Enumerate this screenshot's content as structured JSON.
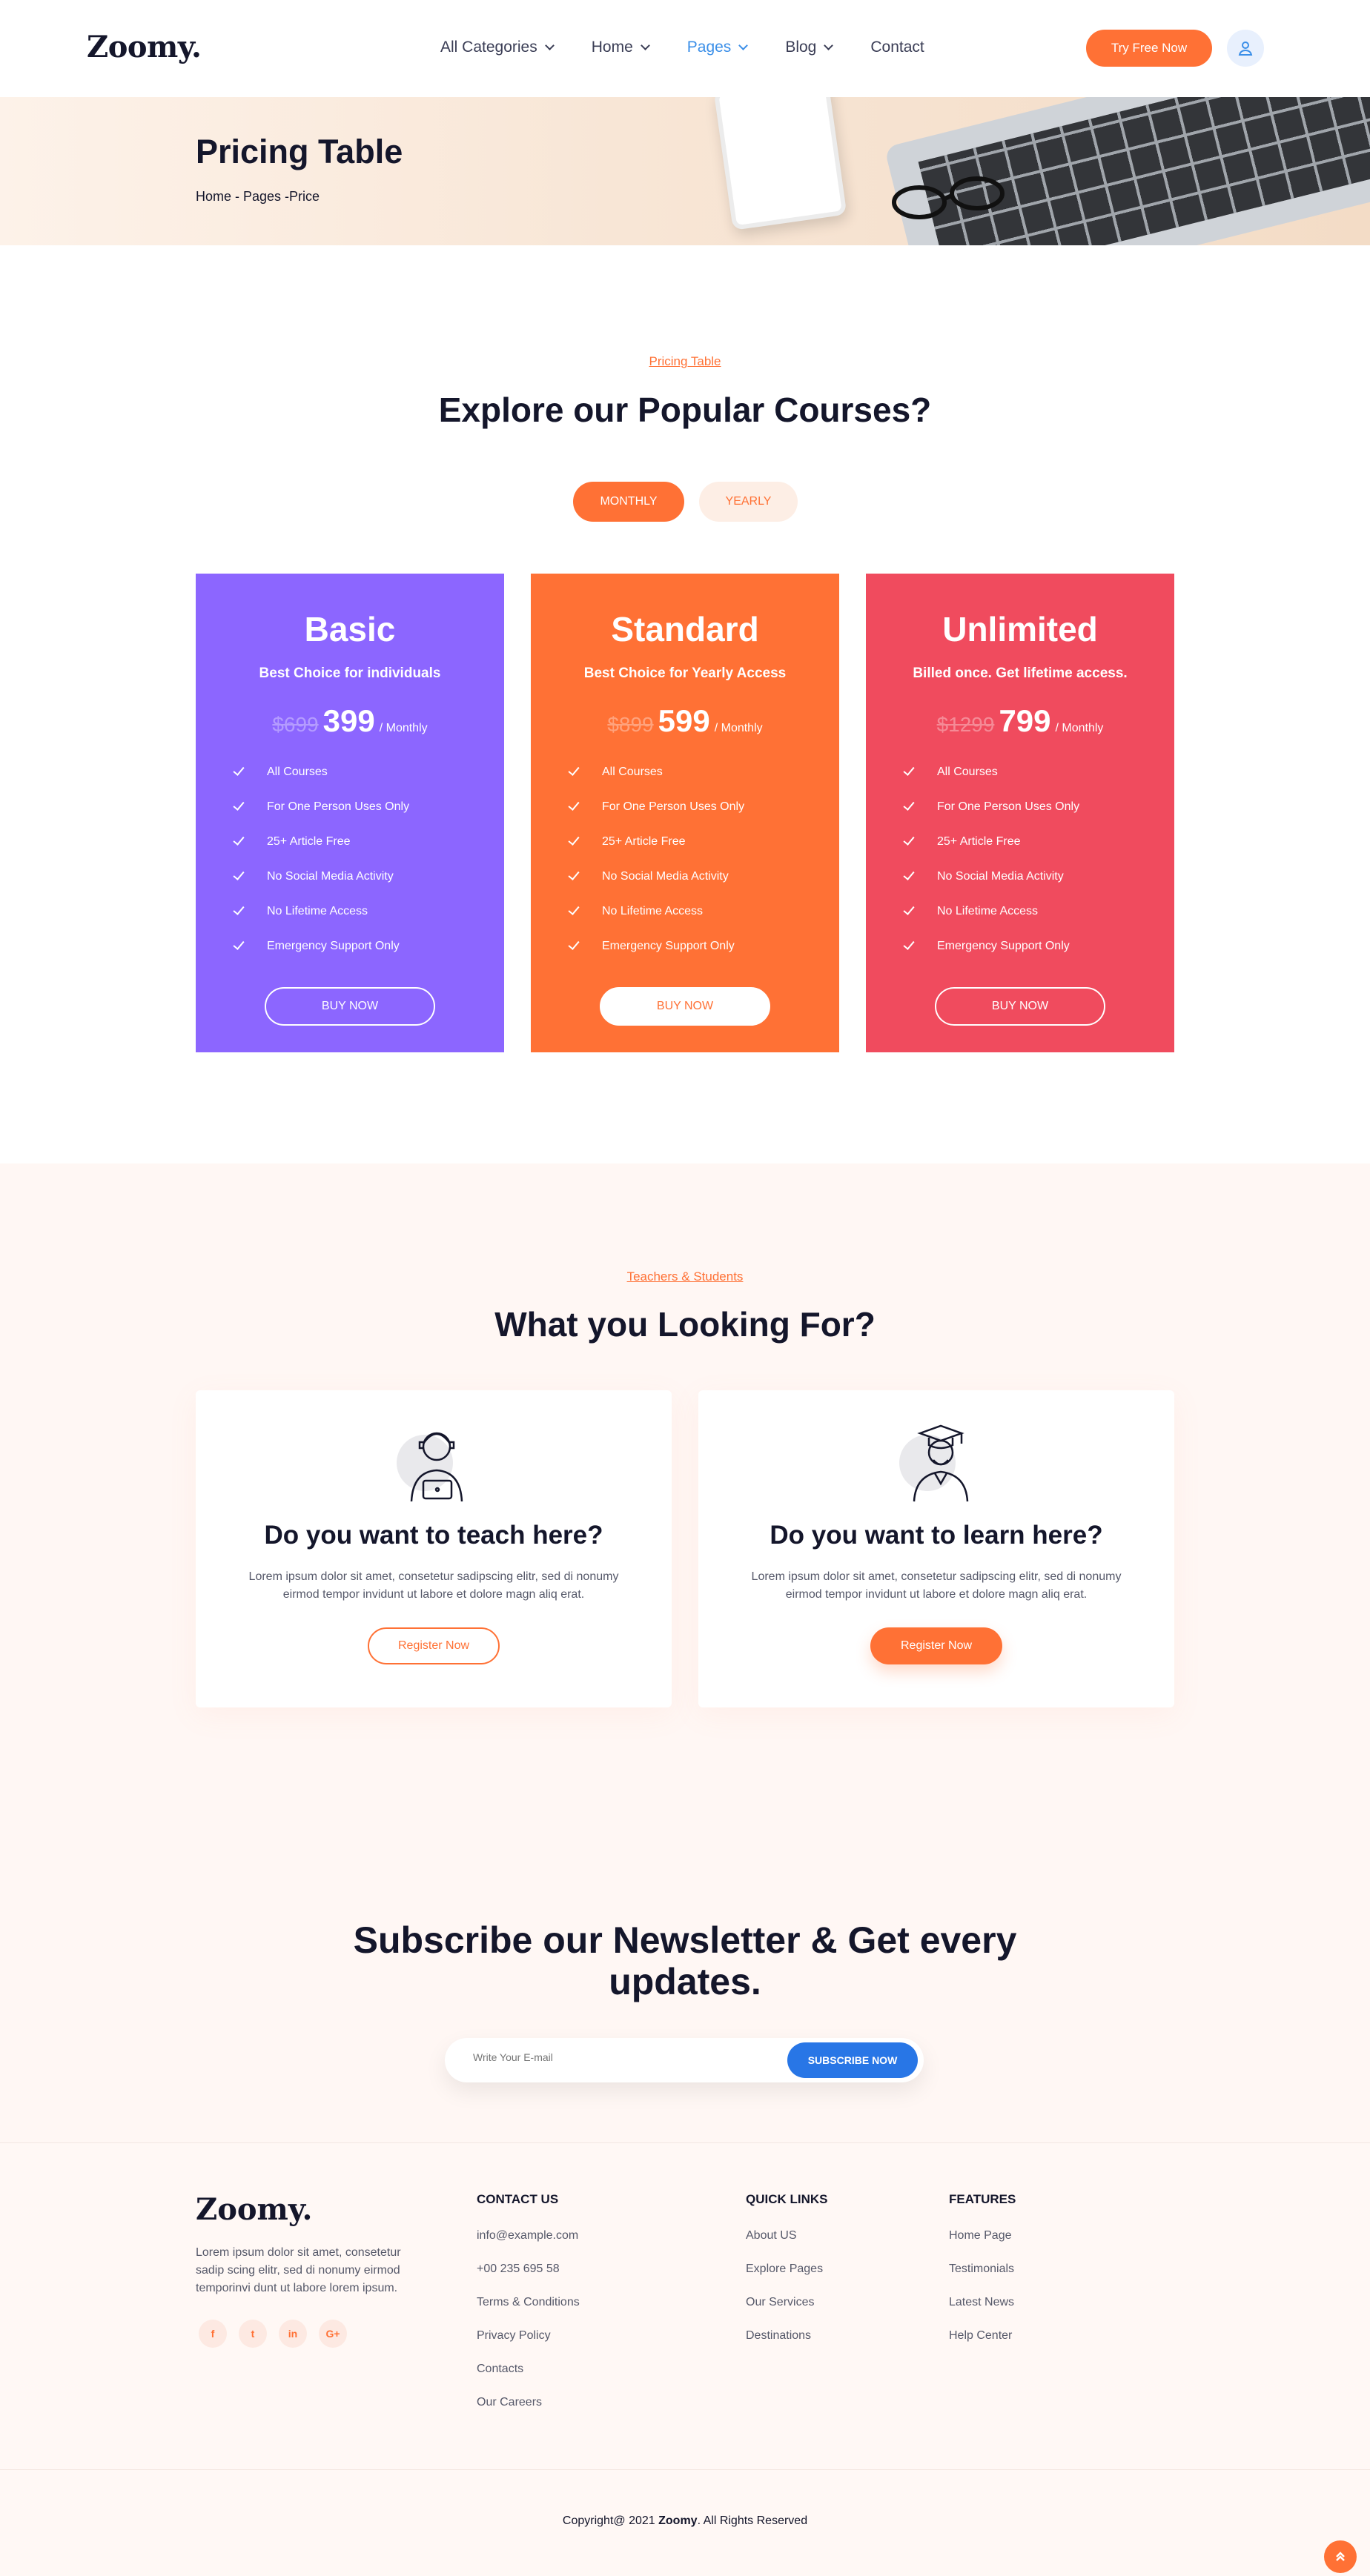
{
  "brand": {
    "logo": "Zoomy.",
    "accent": "#ff7135",
    "blue": "#2876e6"
  },
  "nav": {
    "items": [
      {
        "label": "All Categories",
        "has_dropdown": true,
        "active": false
      },
      {
        "label": "Home",
        "has_dropdown": true,
        "active": false
      },
      {
        "label": "Pages",
        "has_dropdown": true,
        "active": true
      },
      {
        "label": "Blog",
        "has_dropdown": true,
        "active": false
      },
      {
        "label": "Contact",
        "has_dropdown": false,
        "active": false
      }
    ],
    "cta": "Try Free Now",
    "user_icon": "user-icon"
  },
  "hero": {
    "title": "Pricing Table",
    "breadcrumb": "Home - Pages -Price"
  },
  "pricing": {
    "eyebrow": "Pricing Table",
    "title": "Explore our Popular Courses?",
    "toggle": {
      "monthly": "MONTHLY",
      "yearly": "YEARLY",
      "selected": "monthly"
    },
    "plans": [
      {
        "name": "Basic",
        "subtitle": "Best Choice for individuals",
        "old_price": "$699",
        "price": "399",
        "period": "/ Monthly",
        "color": "#8c66ff",
        "button": "BUY NOW",
        "features": [
          "All Courses",
          "For One Person Uses Only",
          "25+ Article Free",
          "No Social Media Activity",
          "No Lifetime Access",
          "Emergency Support Only"
        ]
      },
      {
        "name": "Standard",
        "subtitle": "Best Choice for Yearly Access",
        "old_price": "$899",
        "price": "599",
        "period": "/ Monthly",
        "color": "#ff7135",
        "button": "BUY NOW",
        "features": [
          "All Courses",
          "For One Person Uses Only",
          "25+ Article Free",
          "No Social Media Activity",
          "No Lifetime Access",
          "Emergency Support Only"
        ]
      },
      {
        "name": "Unlimited",
        "subtitle": "Billed once. Get lifetime access.",
        "old_price": "$1299",
        "price": "799",
        "period": "/ Monthly",
        "color": "#f04b5e",
        "button": "BUY NOW",
        "features": [
          "All Courses",
          "For One Person Uses Only",
          "25+ Article Free",
          "No Social Media Activity",
          "No Lifetime Access",
          "Emergency Support Only"
        ]
      }
    ]
  },
  "looking": {
    "eyebrow": "Teachers & Students",
    "title": "What you Looking For?",
    "cards": [
      {
        "icon": "teacher-icon",
        "title": "Do you want to teach here?",
        "description": "Lorem ipsum dolor sit amet, consetetur sadipscing elitr, sed di nonumy eirmod tempor invidunt ut labore et dolore magn aliq erat.",
        "button": "Register Now"
      },
      {
        "icon": "student-icon",
        "title": "Do you want to learn here?",
        "description": "Lorem ipsum dolor sit amet, consetetur sadipscing elitr, sed di nonumy eirmod tempor invidunt ut labore et dolore magn aliq erat.",
        "button": "Register Now"
      }
    ]
  },
  "newsletter": {
    "title": "Subscribe our Newsletter & Get every updates.",
    "placeholder": "Write Your E-mail",
    "button": "SUBSCRIBE NOW"
  },
  "footer": {
    "logo": "Zoomy.",
    "about": "Lorem ipsum dolor sit amet, consetetur sadip scing elitr, sed di nonumy eirmod temporinvi dunt ut labore lorem ipsum.",
    "socials": [
      {
        "icon": "facebook-icon",
        "glyph": "f"
      },
      {
        "icon": "twitter-icon",
        "glyph": "t"
      },
      {
        "icon": "linkedin-icon",
        "glyph": "in"
      },
      {
        "icon": "google-plus-icon",
        "glyph": "G+"
      }
    ],
    "columns": [
      {
        "title": "CONTACT US",
        "items": [
          "info@example.com",
          "+00 235 695 58",
          "Terms & Conditions",
          "Privacy Policy",
          "Contacts",
          "Our Careers"
        ]
      },
      {
        "title": "QUICK LINKS",
        "items": [
          "About US",
          "Explore Pages",
          "Our Services",
          "Destinations"
        ]
      },
      {
        "title": "FEATURES",
        "items": [
          "Home Page",
          "Testimonials",
          "Latest News",
          "Help Center"
        ]
      }
    ],
    "copyright_prefix": "Copyright@ 2021",
    "copyright_brand": "Zoomy",
    "copyright_suffix": ". All Rights Reserved"
  }
}
